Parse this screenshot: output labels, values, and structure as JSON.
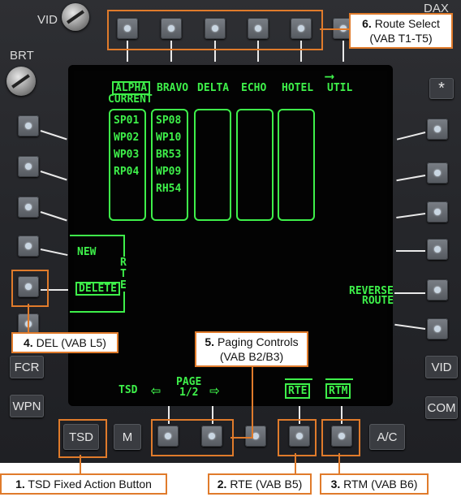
{
  "bezel": {
    "vid_knob_label": "VID",
    "brt_knob_label": "BRT",
    "dax_label": "DAX",
    "left_buttons": {
      "fcr": "FCR",
      "wpn": "WPN"
    },
    "right_buttons": {
      "star": "*",
      "vid": "VID",
      "com": "COM"
    },
    "bottom_buttons": {
      "tsd": "TSD",
      "m": "M",
      "ac": "A/C"
    }
  },
  "screen": {
    "routes": [
      {
        "label": "ALPHA",
        "sub": "CURRENT",
        "waypoints": [
          "SP01",
          "WP02",
          "WP03",
          "RP04"
        ]
      },
      {
        "label": "BRAVO",
        "waypoints": [
          "SP08",
          "WP10",
          "BR53",
          "WP09",
          "RH54"
        ]
      },
      {
        "label": "DELTA",
        "waypoints": []
      },
      {
        "label": "ECHO",
        "waypoints": []
      },
      {
        "label": "HOTEL",
        "waypoints": []
      }
    ],
    "util": "UTIL",
    "rte_bracket": [
      "R",
      "T",
      "E"
    ],
    "new": "NEW",
    "delete": "DELETE",
    "reverse_route": [
      "REVERSE",
      "ROUTE"
    ],
    "tsd": "TSD",
    "page": [
      "PAGE",
      "1/2"
    ],
    "page_left": "⇦",
    "page_right": "⇨",
    "rte": "RTE",
    "rtm": "RTM"
  },
  "callouts": {
    "c1": {
      "num": "1.",
      "text": "TSD Fixed Action Button"
    },
    "c2": {
      "num": "2.",
      "text": "RTE (VAB B5)"
    },
    "c3": {
      "num": "3.",
      "text": "RTM (VAB B6)"
    },
    "c4": {
      "num": "4.",
      "text": "DEL (VAB L5)"
    },
    "c5": {
      "num": "5.",
      "text": "Paging Controls",
      "line2": "(VAB B2/B3)"
    },
    "c6": {
      "num": "6.",
      "text": "Route Select",
      "line2": "(VAB T1-T5)"
    }
  },
  "colors": {
    "symbology": "#3ef04a",
    "callout": "#e07b2b"
  }
}
